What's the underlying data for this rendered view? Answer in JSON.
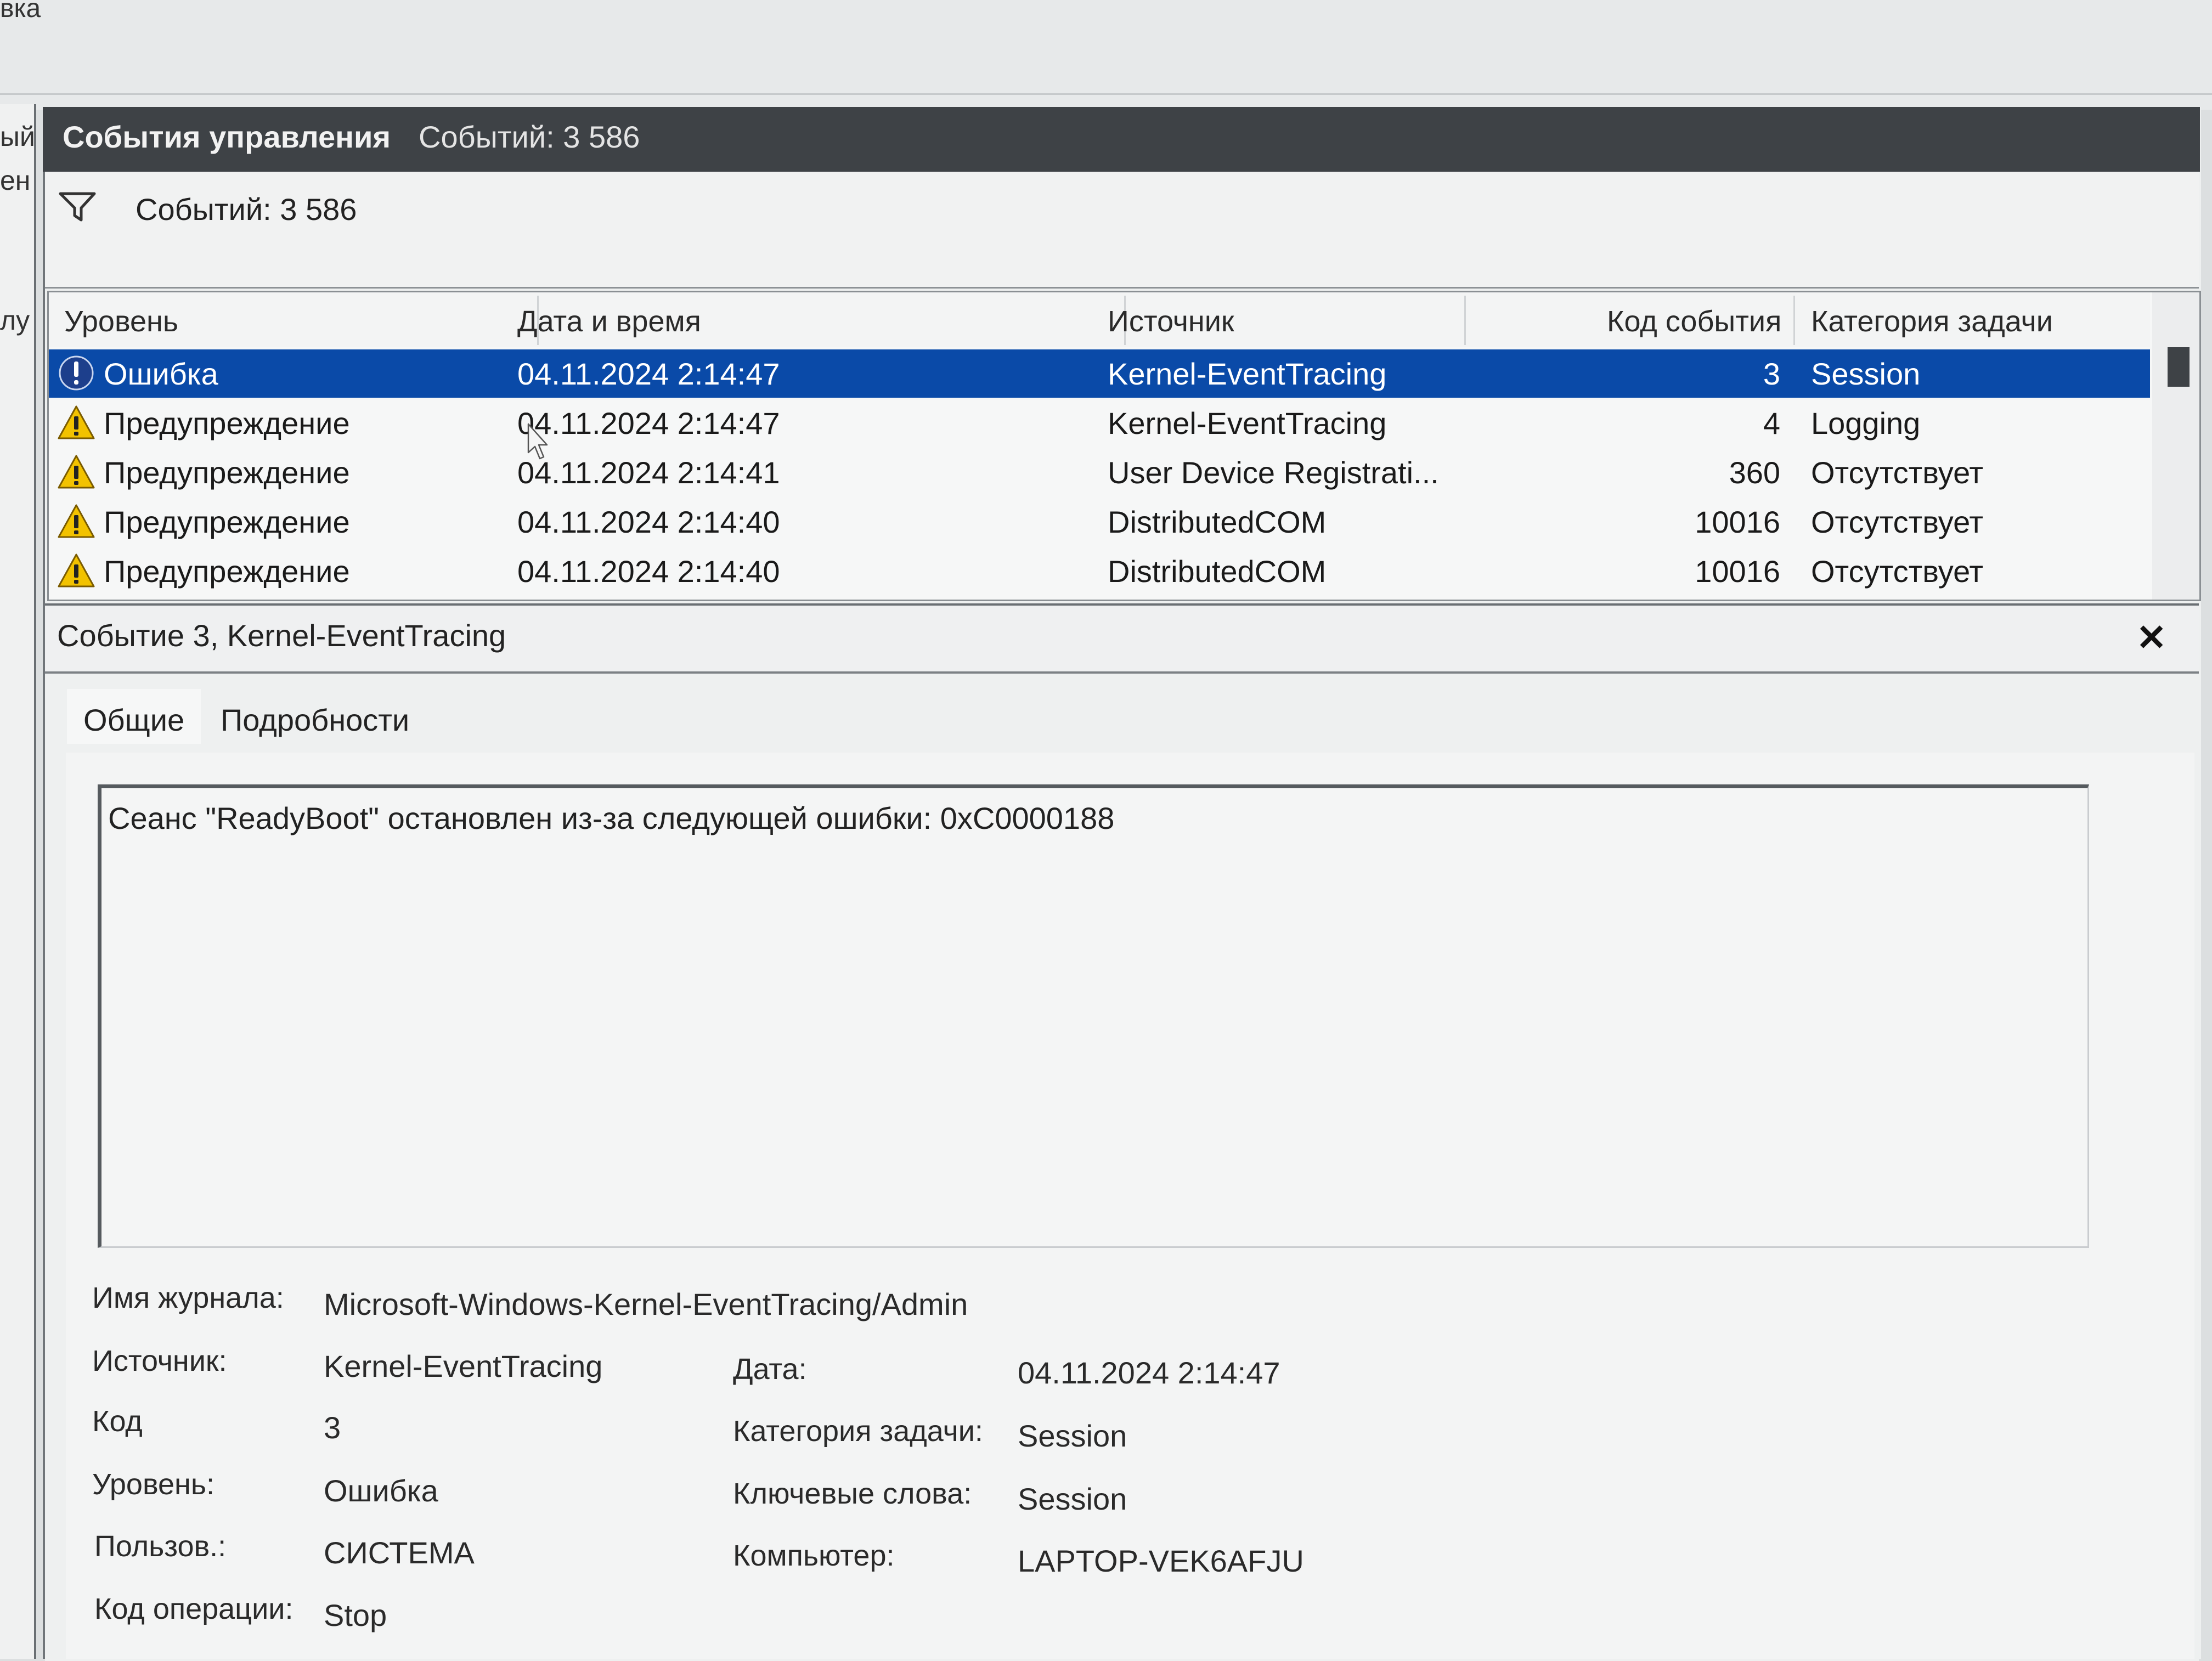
{
  "window": {
    "menu_fragment": "вка",
    "left_pane_fragments": [
      "ый",
      "ен",
      "лу"
    ]
  },
  "titlebar": {
    "title": "События управления",
    "count": "Событий: 3 586"
  },
  "filter": {
    "text": "Событий: 3 586",
    "icon": "filter-icon"
  },
  "table": {
    "columns": [
      "Уровень",
      "Дата и время",
      "Источник",
      "Код события",
      "Категория задачи"
    ],
    "rows": [
      {
        "level": "Ошибка",
        "level_icon": "error-icon",
        "datetime": "04.11.2024 2:14:47",
        "source": "Kernel-EventTracing",
        "code": "3",
        "category": "Session",
        "selected": true
      },
      {
        "level": "Предупреждение",
        "level_icon": "warning-icon",
        "datetime": "04.11.2024 2:14:47",
        "source": "Kernel-EventTracing",
        "code": "4",
        "category": "Logging",
        "selected": false
      },
      {
        "level": "Предупреждение",
        "level_icon": "warning-icon",
        "datetime": "04.11.2024 2:14:41",
        "source": "User Device Registrati...",
        "code": "360",
        "category": "Отсутствует",
        "selected": false
      },
      {
        "level": "Предупреждение",
        "level_icon": "warning-icon",
        "datetime": "04.11.2024 2:14:40",
        "source": "DistributedCOM",
        "code": "10016",
        "category": "Отсутствует",
        "selected": false
      },
      {
        "level": "Предупреждение",
        "level_icon": "warning-icon",
        "datetime": "04.11.2024 2:14:40",
        "source": "DistributedCOM",
        "code": "10016",
        "category": "Отсутствует",
        "selected": false
      }
    ]
  },
  "details": {
    "title": "Событие 3, Kernel-EventTracing",
    "close_label": "✕",
    "tabs": [
      "Общие",
      "Подробности"
    ],
    "message": "Сеанс \"ReadyBoot\" остановлен из-за следующей ошибки: 0xC0000188",
    "fields": {
      "log_name_label": "Имя журнала:",
      "log_name": "Microsoft-Windows-Kernel-EventTracing/Admin",
      "source_label": "Источник:",
      "source": "Kernel-EventTracing",
      "date_label": "Дата:",
      "date": "04.11.2024 2:14:47",
      "code_label": "Код",
      "code": "3",
      "task_label": "Категория задачи:",
      "task": "Session",
      "level_label": "Уровень:",
      "level": "Ошибка",
      "keywords_label": "Ключевые слова:",
      "keywords": "Session",
      "user_label": "Пользов.:",
      "user": "СИСТЕМА",
      "computer_label": "Компьютер:",
      "computer": "LAPTOP-VEK6AFJU",
      "opcode_label": "Код операции:",
      "opcode": "Stop"
    }
  },
  "colors": {
    "selection": "#0a4aa8",
    "titlebar": "#3e4246",
    "warning": "#f2c200",
    "error": "#1d3f8c"
  }
}
